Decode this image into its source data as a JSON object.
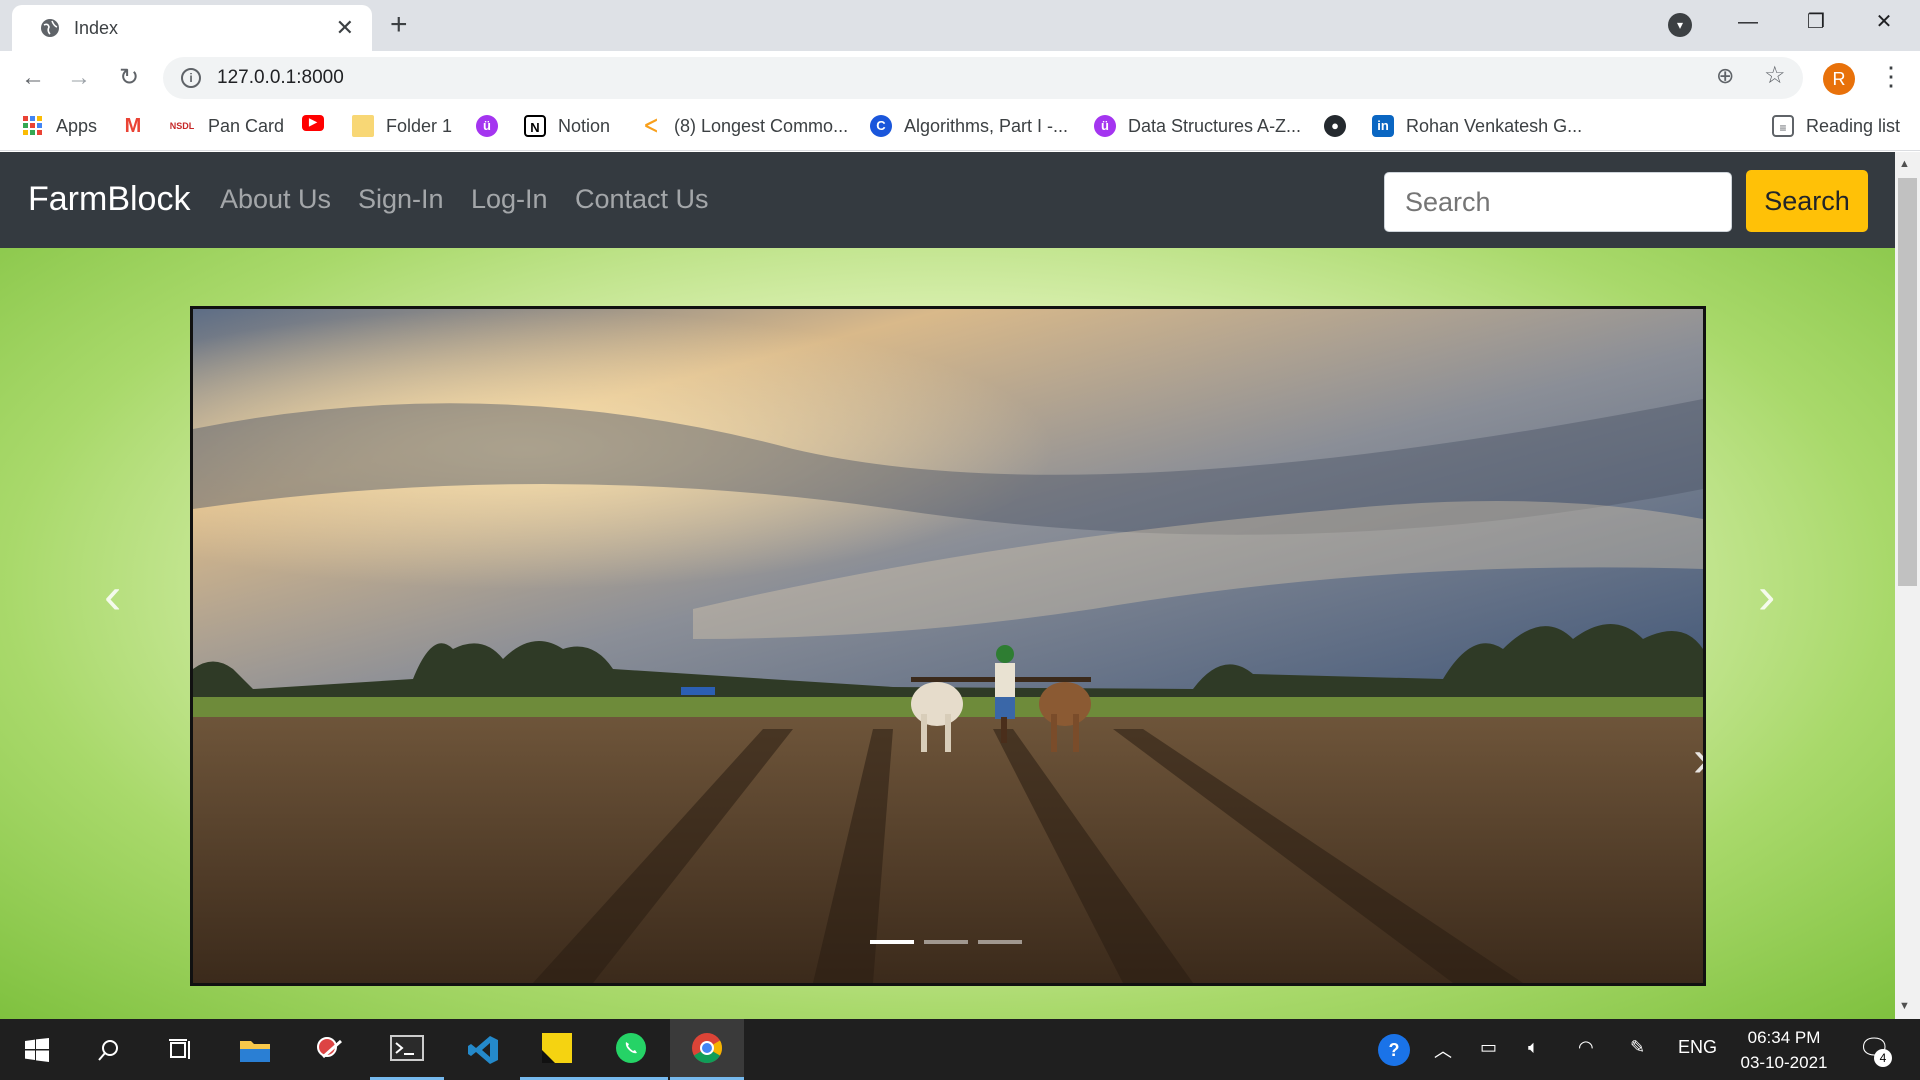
{
  "browser": {
    "tab": {
      "title": "Index"
    },
    "address": {
      "url": "127.0.0.1:8000"
    },
    "profile_initial": "R",
    "bookmarks": [
      {
        "label": "Apps",
        "icon": "apps-grid-icon"
      },
      {
        "label": "",
        "icon": "gmail-icon"
      },
      {
        "label": "Pan Card",
        "icon": "nsdl-icon"
      },
      {
        "label": "",
        "icon": "youtube-icon"
      },
      {
        "label": "Folder 1",
        "icon": "folder-icon"
      },
      {
        "label": "",
        "icon": "coursera-icon"
      },
      {
        "label": "Notion",
        "icon": "notion-icon"
      },
      {
        "label": "(8) Longest Commo...",
        "icon": "leetcode-icon"
      },
      {
        "label": "Algorithms, Part I -...",
        "icon": "coursera-c-icon"
      },
      {
        "label": "Data Structures A-Z...",
        "icon": "udemy-icon"
      },
      {
        "label": "",
        "icon": "github-icon"
      },
      {
        "label": "Rohan Venkatesh G...",
        "icon": "linkedin-icon"
      }
    ],
    "reading_list": "Reading list"
  },
  "site": {
    "brand": "FarmBlock",
    "nav": [
      "About Us",
      "Sign-In",
      "Log-In",
      "Contact Us"
    ],
    "search": {
      "placeholder": "Search",
      "button": "Search"
    }
  },
  "taskbar": {
    "language": "ENG",
    "time": "06:34 PM",
    "date": "03-10-2021",
    "notifications": "4"
  },
  "colors": {
    "navbar": "#343a40",
    "search_button": "#ffc107",
    "profile": "#e8710a"
  }
}
